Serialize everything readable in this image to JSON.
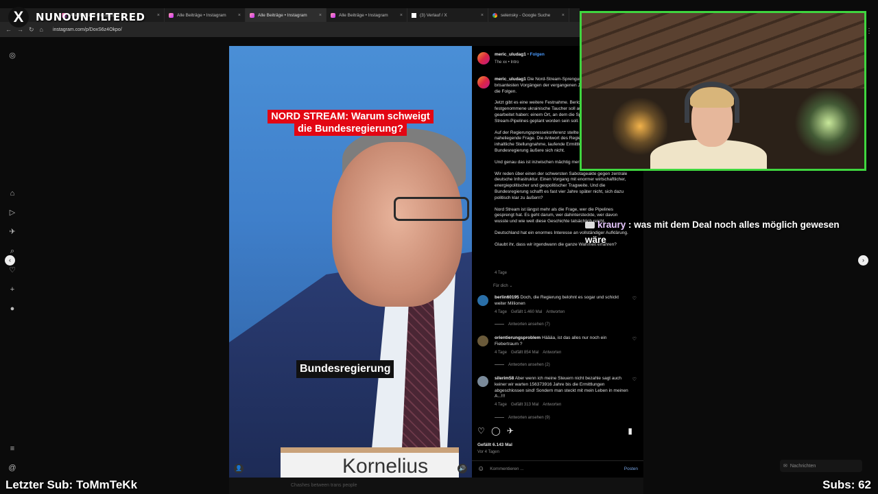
{
  "overlay": {
    "brand_name": "NUNOUNFILTERED",
    "last_sub": "Letzter Sub: ToMmTeKk",
    "subs": "Subs: 62"
  },
  "browser": {
    "tabs": [
      {
        "label": "Alle Beiträge • Instagram",
        "icon": "instagram"
      },
      {
        "label": "Alle Beiträge • Instagram",
        "icon": "instagram"
      },
      {
        "label": "Alle Beiträge • Instagram",
        "icon": "instagram",
        "active": true
      },
      {
        "label": "Alle Beiträge • Instagram",
        "icon": "instagram"
      },
      {
        "label": "(3) Verlauf / X",
        "icon": "x"
      },
      {
        "label": "selensky - Google Suche",
        "icon": "google"
      }
    ],
    "url": "instagram.com/p/DoxS6z4Okpo/"
  },
  "video": {
    "headline": "NORD STREAM: Warum schweigt die Bundesregierung?",
    "subtitle": "Bundesregierung",
    "nameplate": "Kornelius"
  },
  "post": {
    "author": "meric_uludag1",
    "follow": "Folgen",
    "audio": "The xx • Intro",
    "caption_paragraphs": [
      "Die Nord-Stream-Sprengung gehört zu den brisantesten Vorgängen der vergangenen Jahre. Deutschland trägt die Folgen.",
      "Jetzt gibt es eine weitere Festnahme. Berichten zufolge: Der festgenommene ukrainische Taucher soll auf der „Snake Island\" gearbeitet haben: einem Ort, an dem die Sprengung der Nord-Stream-Pipelines geplant worden sein soll.",
      "Auf der Regierungspressekonferenz stellte @florianwarweg dazu die naheliegende Frage. Die Antwort des Regierungssprechers? Keine inhaltliche Stellungnahme, laufende Ermittlungen. Die Bundesregierung äußere sich nicht.",
      "Und genau das ist inzwischen mächtig merkwürdig.",
      "Wir reden über einen der schwersten Sabotageakte gegen zentrale deutsche Infrastruktur. Einen Vorgang mit enormer wirtschaftlicher, energiepolitischer und geopolitischer Tragweite. Und die Bundesregierung schafft es fast vier Jahre später nicht, sich dazu politisch klar zu äußern?",
      "Nord Stream ist längst mehr als die Frage, wer die Pipelines gesprengt hat. Es geht darum, wer dahintersteckte, wer davon wusste und wie weit diese Geschichte tatsächlich reicht.",
      "Deutschland hat ein enormes Interesse an vollständiger Aufklärung.",
      "Glaubt ihr, dass wir irgendwann die ganze Wahrheit erfahren?"
    ],
    "caption_age": "4 Tage",
    "translate": "Für dich",
    "comments": [
      {
        "user": "berlin60195",
        "text": "Doch, die Regierung belohnt es sogar und schickt weiter Millionen",
        "age": "4 Tage",
        "likes": "Gefällt 1.460 Mal",
        "reply": "Antworten",
        "replies": "Antworten ansehen (7)"
      },
      {
        "user": "orientierungsproblem",
        "text": "Häääa, ist das alles nur noch ein Fiebertraum ?",
        "age": "4 Tage",
        "likes": "Gefällt 854 Mal",
        "reply": "Antworten",
        "replies": "Antworten ansehen (2)"
      },
      {
        "user": "silerim58",
        "text": "Aber wenn ich meine Steuern nicht bezahle sagt auch keiner wir warten 156373916 Jahre bis die Ermittlungen abgeschlossen sind! Sondern man steckt mit mein Leben in meinen A...!!!",
        "age": "4 Tage",
        "likes": "Gefällt 313 Mal",
        "reply": "Antworten",
        "replies": "Antworten ansehen (9)"
      }
    ],
    "total_likes": "Gefällt 6.143 Mal",
    "posted": "Vor 4 Tagen",
    "comment_placeholder": "Kommentieren ...",
    "post_button": "Posten"
  },
  "chat": {
    "user": "kraury",
    "message": ": was mit dem Deal noch alles möglich gewesen wäre"
  },
  "messages_widget": "Nachrichten",
  "bottom_text": "Chashes between trans people",
  "colors": {
    "accent_red": "#e30613",
    "webcam_border": "#3fd63f",
    "follow_blue": "#4a9bff"
  }
}
